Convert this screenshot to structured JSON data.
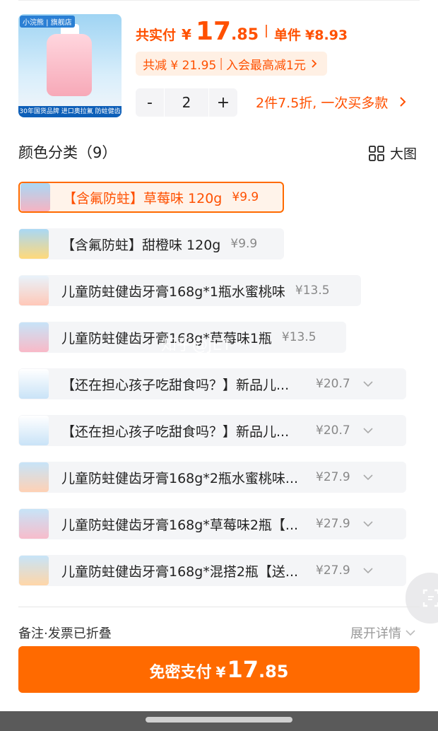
{
  "product": {
    "brand_badge": "小浣熊 | 旗舰店",
    "image_strip_text": "30年国货品牌 进口奥拉氟 防蛀健齿",
    "total_label": "共实付",
    "currency": "¥",
    "total_int": "17",
    "total_dec": ".85",
    "unit_label": "单件",
    "unit_price": "¥8.93",
    "discount_text": "共减 ¥ 21.95",
    "member_text": "入会最高减1元",
    "quantity": "2",
    "minus": "-",
    "plus": "+",
    "multi_buy_promo": "2件7.5折, 一次买多款"
  },
  "section": {
    "title": "颜色分类（9）",
    "view_toggle": "大图"
  },
  "variants": [
    {
      "name": "【含氟防蛀】草莓味 120g",
      "price": "¥9.9",
      "selected": true,
      "color": "#f7b3c2"
    },
    {
      "name": "【含氟防蛀】甜橙味 120g",
      "price": "¥9.9",
      "selected": false,
      "color": "#ffd97a"
    },
    {
      "name": "儿童防蛀健齿牙膏168g*1瓶水蜜桃味",
      "price": "¥13.5",
      "selected": false,
      "color": "#ffc8b8"
    },
    {
      "name": "儿童防蛀健齿牙膏168g*草莓味1瓶",
      "price": "¥13.5",
      "selected": false,
      "color": "#f9b9c7"
    },
    {
      "name": "【还在担心孩子吃甜食吗？】新品儿...",
      "price": "¥20.7",
      "selected": false,
      "color": "#c9e3f7"
    },
    {
      "name": "【还在担心孩子吃甜食吗？】新品儿...",
      "price": "¥20.7",
      "selected": false,
      "color": "#c9e3f7"
    },
    {
      "name": "儿童防蛀健齿牙膏168g*2瓶水蜜桃味...",
      "price": "¥27.9",
      "selected": false,
      "color": "#ffd1b5"
    },
    {
      "name": "儿童防蛀健齿牙膏168g*草莓味2瓶【...",
      "price": "¥27.9",
      "selected": false,
      "color": "#f7bccb"
    },
    {
      "name": "儿童防蛀健齿牙膏168g*混搭2瓶【送...",
      "price": "¥27.9",
      "selected": false,
      "color": "#ffd6a8"
    }
  ],
  "watermark": "知乎@JET",
  "footer": {
    "remark": "备注·发票已折叠",
    "expand": "展开详情",
    "pay_label": "免密支付",
    "pay_currency": "¥",
    "pay_int": "17",
    "pay_dec": ".85"
  },
  "colors": {
    "accent": "#ff6a00",
    "price": "#ff5000"
  }
}
